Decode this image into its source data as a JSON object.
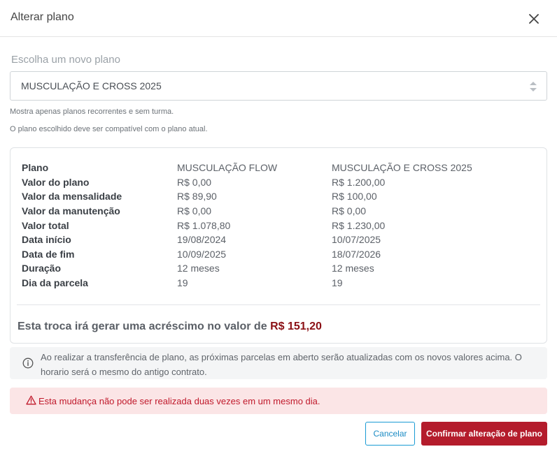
{
  "modal": {
    "title": "Alterar plano",
    "close_icon": "close-icon"
  },
  "plan_select": {
    "label": "Escolha um novo plano",
    "value": "MUSCULAÇÃO E CROSS 2025",
    "arrows_icon": "select-arrows-icon"
  },
  "hints": [
    "Mostra apenas planos recorrentes e sem turma.",
    "O plano escolhido deve ser compatível com o plano atual."
  ],
  "comparison": {
    "rows": [
      {
        "label": "Plano",
        "current": "MUSCULAÇÃO FLOW",
        "new": "MUSCULAÇÃO E CROSS 2025"
      },
      {
        "label": "Valor do plano",
        "current": "R$ 0,00",
        "new": "R$ 1.200,00"
      },
      {
        "label": "Valor da mensalidade",
        "current": "R$ 89,90",
        "new": "R$ 100,00"
      },
      {
        "label": "Valor da manutenção",
        "current": "R$ 0,00",
        "new": "R$ 0,00"
      },
      {
        "label": "Valor total",
        "current": "R$ 1.078,80",
        "new": "R$ 1.230,00"
      },
      {
        "label": "Data início",
        "current": "19/08/2024",
        "new": "10/07/2025"
      },
      {
        "label": "Data de fim",
        "current": "10/09/2025",
        "new": "18/07/2026"
      },
      {
        "label": "Duração",
        "current": "12 meses",
        "new": "12 meses"
      },
      {
        "label": "Dia da parcela",
        "current": "19",
        "new": "19"
      }
    ],
    "summary_text": "Esta troca irá gerar uma acréscimo no valor de",
    "summary_amount": "R$ 151,20"
  },
  "info": {
    "icon": "info-circle-icon",
    "text": "Ao realizar a transferência de plano, as próximas parcelas em aberto serão atualizadas com os novos valores acima. O horario será o mesmo do antigo contrato."
  },
  "alert": {
    "icon": "warning-triangle-icon",
    "text": "Esta mudança não pode ser realizada duas vezes em um mesmo dia."
  },
  "buttons": {
    "cancel": "Cancelar",
    "confirm": "Confirmar alteração de plano"
  },
  "colors": {
    "accent_red": "#b41c2c",
    "amount_red": "#8b1015",
    "cancel_blue": "#1a9bd4",
    "alert_bg": "#fbe5e6",
    "alert_text": "#c0192b"
  }
}
